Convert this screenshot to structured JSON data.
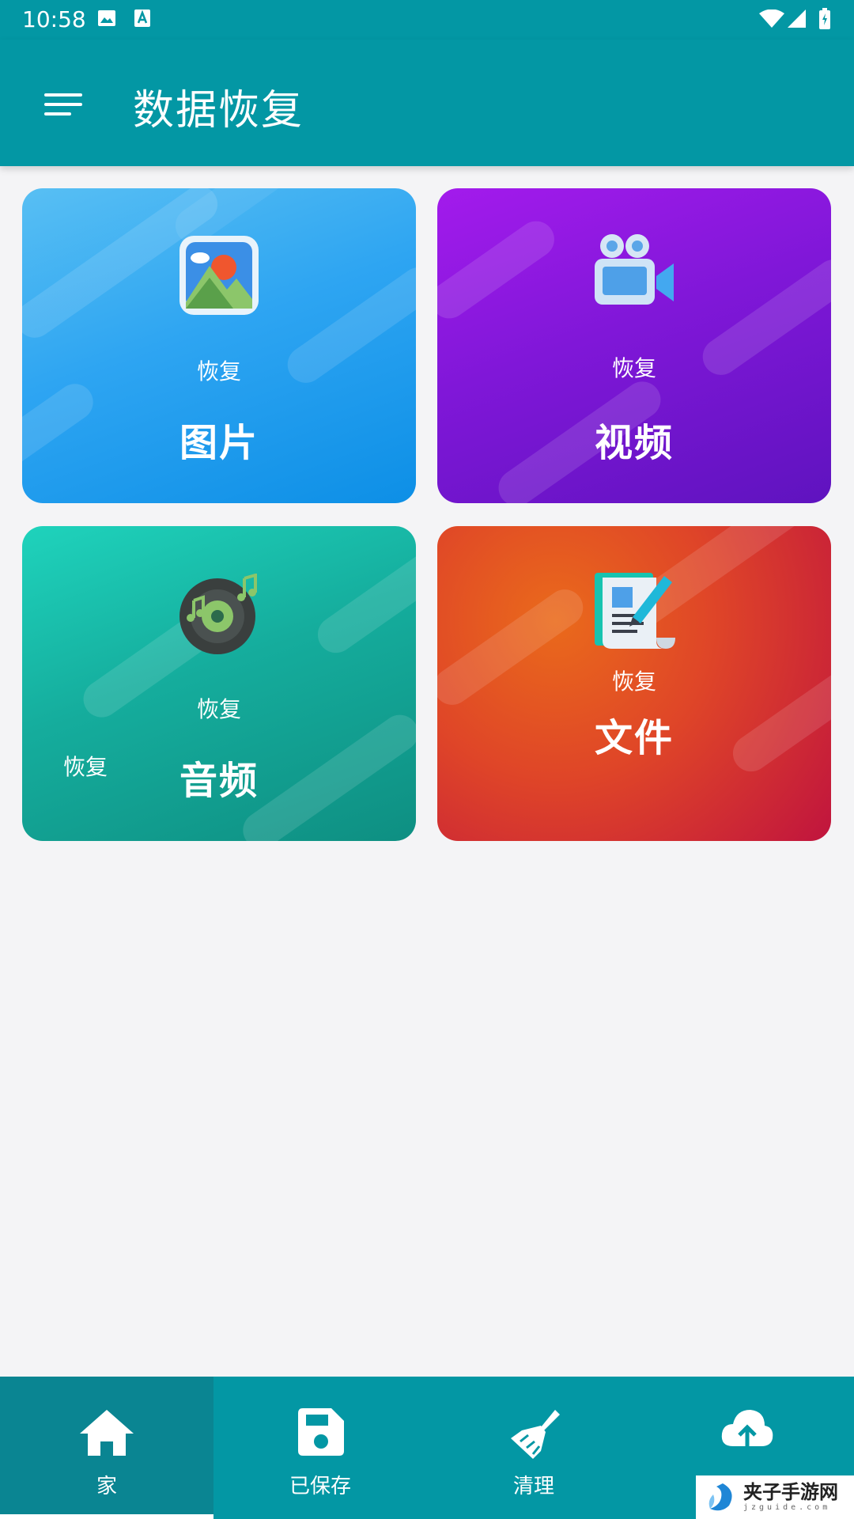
{
  "status_bar": {
    "time": "10:58"
  },
  "app_bar": {
    "title": "数据恢复",
    "menu_icon": "menu-icon"
  },
  "cards": {
    "photo": {
      "subtitle": "恢复",
      "title": "图片",
      "icon": "picture-icon"
    },
    "video": {
      "subtitle": "恢复",
      "title": "视频",
      "icon": "video-camera-icon"
    },
    "audio": {
      "subtitle": "恢复",
      "title": "音频",
      "icon": "music-disc-icon",
      "extra_label": "恢复"
    },
    "file": {
      "subtitle": "恢复",
      "title": "文件",
      "icon": "document-pen-icon"
    }
  },
  "bottom_nav": {
    "items": [
      {
        "label": "家",
        "icon": "home-icon",
        "active": true
      },
      {
        "label": "已保存",
        "icon": "save-icon",
        "active": false
      },
      {
        "label": "清理",
        "icon": "broom-icon",
        "active": false
      },
      {
        "label": "",
        "icon": "cloud-upload-icon",
        "active": false
      }
    ]
  },
  "watermark": {
    "text": "夹子手游网",
    "sub": "jzguide.com"
  },
  "colors": {
    "primary": "#0397a4",
    "background": "#f4f4f6"
  }
}
